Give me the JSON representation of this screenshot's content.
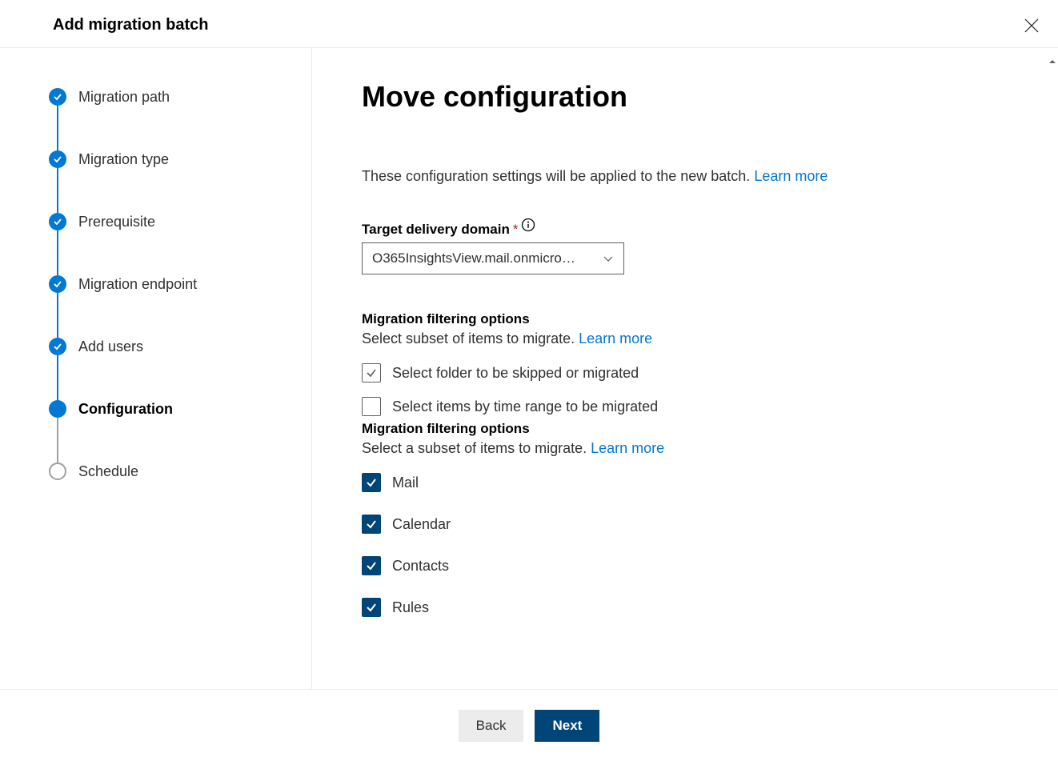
{
  "header": {
    "title": "Add migration batch"
  },
  "steps": [
    {
      "label": "Migration path",
      "state": "completed"
    },
    {
      "label": "Migration type",
      "state": "completed"
    },
    {
      "label": "Prerequisite",
      "state": "completed"
    },
    {
      "label": "Migration endpoint",
      "state": "completed"
    },
    {
      "label": "Add users",
      "state": "completed"
    },
    {
      "label": "Configuration",
      "state": "current"
    },
    {
      "label": "Schedule",
      "state": "upcoming"
    }
  ],
  "content": {
    "title": "Move configuration",
    "intro_text": "These configuration settings will be applied to the new batch. ",
    "intro_learn_more": "Learn more",
    "target_domain_label": "Target delivery domain",
    "target_domain_value": "O365InsightsView.mail.onmicro…",
    "filter1_title": "Migration filtering options",
    "filter1_sub_text": "Select subset of items to migrate. ",
    "filter1_sub_link": "Learn more",
    "filter1_opt_folder": "Select folder to be skipped or migrated",
    "filter1_opt_time": "Select items by time range to be migrated",
    "filter2_title": "Migration filtering options",
    "filter2_sub_text": "Select a subset of items to migrate. ",
    "filter2_sub_link": "Learn more",
    "items": {
      "mail": "Mail",
      "calendar": "Calendar",
      "contacts": "Contacts",
      "rules": "Rules"
    }
  },
  "footer": {
    "back": "Back",
    "next": "Next"
  }
}
